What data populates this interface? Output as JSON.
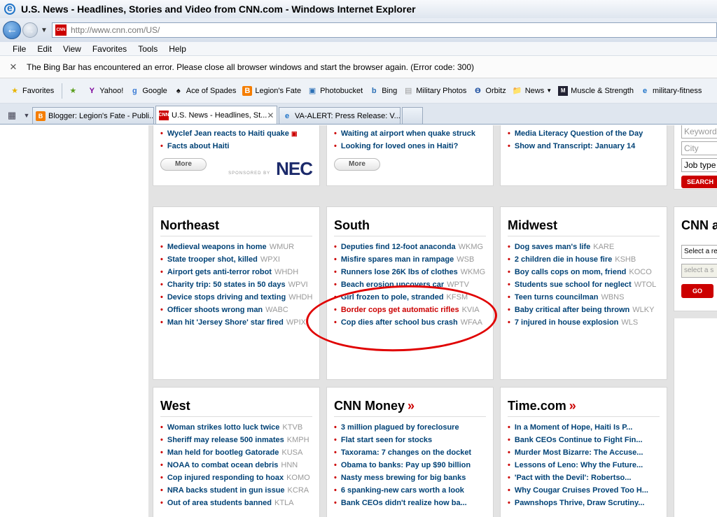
{
  "window": {
    "title": "U.S. News - Headlines, Stories and Video from CNN.com - Windows Internet Explorer"
  },
  "address_bar": {
    "url": "http://www.cnn.com/US/"
  },
  "menu": [
    "File",
    "Edit",
    "View",
    "Favorites",
    "Tools",
    "Help"
  ],
  "info_bar": {
    "message": "The Bing Bar has encountered an error.  Please close all browser windows and start the browser again. (Error code: 300)"
  },
  "favorites_bar": {
    "favorites_label": "Favorites",
    "items": [
      {
        "label": "Yahoo!",
        "icon": "yahoo-icon"
      },
      {
        "label": "Google",
        "icon": "google-icon"
      },
      {
        "label": "Ace of Spades",
        "icon": "spade-icon"
      },
      {
        "label": "Legion's Fate",
        "icon": "blogger-icon"
      },
      {
        "label": "Photobucket",
        "icon": "photobucket-icon"
      },
      {
        "label": "Bing",
        "icon": "bing-icon"
      },
      {
        "label": "Military Photos",
        "icon": "page-icon"
      },
      {
        "label": "Orbitz",
        "icon": "orbitz-icon"
      },
      {
        "label": "News",
        "icon": "folder-icon"
      },
      {
        "label": "Muscle & Strength",
        "icon": "ms-icon"
      },
      {
        "label": "military-fitness",
        "icon": "ie-icon"
      }
    ]
  },
  "tabs": [
    {
      "label": "Blogger: Legion's Fate - Publi...",
      "icon": "blogger-icon",
      "active": false
    },
    {
      "label": "U.S. News - Headlines, St...",
      "icon": "cnn-icon",
      "active": true
    },
    {
      "label": "VA-ALERT: Press Release: V...",
      "icon": "ie-icon",
      "active": false
    }
  ],
  "top_boxes": {
    "box1": {
      "links": [
        "Wyclef Jean reacts to Haiti quake",
        "Facts about Haiti"
      ],
      "more": "More",
      "sponsor_text": "SPONSORED BY",
      "sponsor_logo": "NEC"
    },
    "box2": {
      "links": [
        "Waiting at airport when quake struck",
        "Looking for loved ones in Haiti?"
      ],
      "more": "More"
    },
    "box3": {
      "links": [
        "Media Literacy Question of the Day",
        "Show and Transcript: January 14"
      ]
    }
  },
  "regions": {
    "northeast": {
      "title": "Northeast",
      "stories": [
        {
          "text": "Medieval weapons in home",
          "src": "WMUR"
        },
        {
          "text": "State trooper shot, killed",
          "src": "WPXI"
        },
        {
          "text": "Airport gets anti-terror robot",
          "src": "WHDH"
        },
        {
          "text": "Charity trip: 50 states in 50 days",
          "src": "WPVI"
        },
        {
          "text": "Device stops driving and texting",
          "src": "WHDH"
        },
        {
          "text": "Officer shoots wrong man",
          "src": "WABC"
        },
        {
          "text": "Man hit 'Jersey Shore' star fired",
          "src": "WPIX"
        }
      ]
    },
    "south": {
      "title": "South",
      "stories": [
        {
          "text": "Deputies find 12-foot anaconda",
          "src": "WKMG"
        },
        {
          "text": "Misfire spares man in rampage",
          "src": "WSB"
        },
        {
          "text": "Runners lose 26K lbs of clothes",
          "src": "WKMG"
        },
        {
          "text": "Beach erosion uncovers car",
          "src": "WPTV"
        },
        {
          "text": "Girl frozen to pole, stranded",
          "src": "KFSM"
        },
        {
          "text": "Border cops get automatic rifles",
          "src": "KVIA"
        },
        {
          "text": "Cop dies after school bus crash",
          "src": "WFAA"
        }
      ]
    },
    "midwest": {
      "title": "Midwest",
      "stories": [
        {
          "text": "Dog saves man's life",
          "src": "KARE"
        },
        {
          "text": "2 children die in house fire",
          "src": "KSHB"
        },
        {
          "text": "Boy calls cops on mom, friend",
          "src": "KOCO"
        },
        {
          "text": "Students sue school for neglect",
          "src": "WTOL"
        },
        {
          "text": "Teen turns councilman",
          "src": "WBNS"
        },
        {
          "text": "Baby critical after being thrown",
          "src": "WLKY"
        },
        {
          "text": "7 injured in house explosion",
          "src": "WLS"
        }
      ]
    },
    "west": {
      "title": "West",
      "stories": [
        {
          "text": "Woman strikes lotto luck twice",
          "src": "KTVB"
        },
        {
          "text": "Sheriff may release 500 inmates",
          "src": "KMPH"
        },
        {
          "text": "Man held for bootleg Gatorade",
          "src": "KUSA"
        },
        {
          "text": "NOAA to combat ocean debris",
          "src": "HNN"
        },
        {
          "text": "Cop injured responding to hoax",
          "src": "KOMO"
        },
        {
          "text": "NRA backs student in gun issue",
          "src": "KCRA"
        },
        {
          "text": "Out of area students banned",
          "src": "KTLA"
        }
      ]
    },
    "money": {
      "title": "CNN Money",
      "stories": [
        {
          "text": "3 million plagued by foreclosure",
          "src": ""
        },
        {
          "text": "Flat start seen for stocks",
          "src": ""
        },
        {
          "text": "Taxorama: 7 changes on the docket",
          "src": ""
        },
        {
          "text": "Obama to banks: Pay up $90 billion",
          "src": ""
        },
        {
          "text": "Nasty mess brewing for big banks",
          "src": ""
        },
        {
          "text": "6 spanking-new cars worth a look",
          "src": ""
        },
        {
          "text": "Bank CEOs didn't realize how ba...",
          "src": ""
        }
      ]
    },
    "time": {
      "title": "Time.com",
      "stories": [
        {
          "text": "In a Moment of Hope, Haiti Is P...",
          "src": ""
        },
        {
          "text": "Bank CEOs Continue to Fight Fin...",
          "src": ""
        },
        {
          "text": "Murder Most Bizarre: The Accuse...",
          "src": ""
        },
        {
          "text": "Lessons of Leno: Why the Future...",
          "src": ""
        },
        {
          "text": "'Pact with the Devil': Robertso...",
          "src": ""
        },
        {
          "text": "Why Cougar Cruises Proved Too H...",
          "src": ""
        },
        {
          "text": "Pawnshops Thrive, Draw Scrutiny...",
          "src": ""
        }
      ]
    }
  },
  "sidebar": {
    "job_keyword_placeholder": "Keyword",
    "job_city_placeholder": "City",
    "job_type_value": "Job type",
    "search_label": "SEARCH",
    "cnn_heading": "CNN a",
    "select1": "Select a re",
    "select2": "select a s",
    "go_label": "GO"
  },
  "annotation": {
    "color": "#e00000",
    "highlighted_stories": [
      "Border cops get automatic rifles",
      "Cop dies after school bus crash"
    ]
  }
}
